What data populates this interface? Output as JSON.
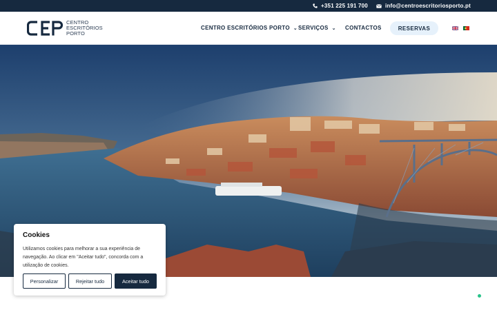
{
  "topbar": {
    "phone": "+351 225 191 700",
    "email": "info@centroescritoriosporto.pt",
    "phone_icon": "phone-icon",
    "email_icon": "envelope-icon"
  },
  "logo": {
    "mark": "CEP",
    "line1": "CENTRO",
    "line2": "ESCRITÓRIOS",
    "line3": "PORTO"
  },
  "nav": {
    "items": [
      {
        "label": "CENTRO ESCRITÓRIOS PORTO",
        "has_dropdown": true
      },
      {
        "label": "SERVIÇOS",
        "has_dropdown": true
      },
      {
        "label": "CONTACTOS",
        "has_dropdown": false
      }
    ],
    "cta": "RESERVAS",
    "languages": [
      "English",
      "Português"
    ]
  },
  "cookies": {
    "title": "Cookies",
    "text": "Utilizamos cookies para melhorar a sua experiência de navegação. Ao clicar em \"Aceitar tudo\", concorda com a utilização de cookies.",
    "customize": "Personalizar",
    "reject": "Rejeitar tudo",
    "accept": "Aceitar tudo"
  },
  "colors": {
    "navy": "#16293f",
    "cta_bg": "#e6f1fb",
    "status_green": "#28c38a"
  }
}
